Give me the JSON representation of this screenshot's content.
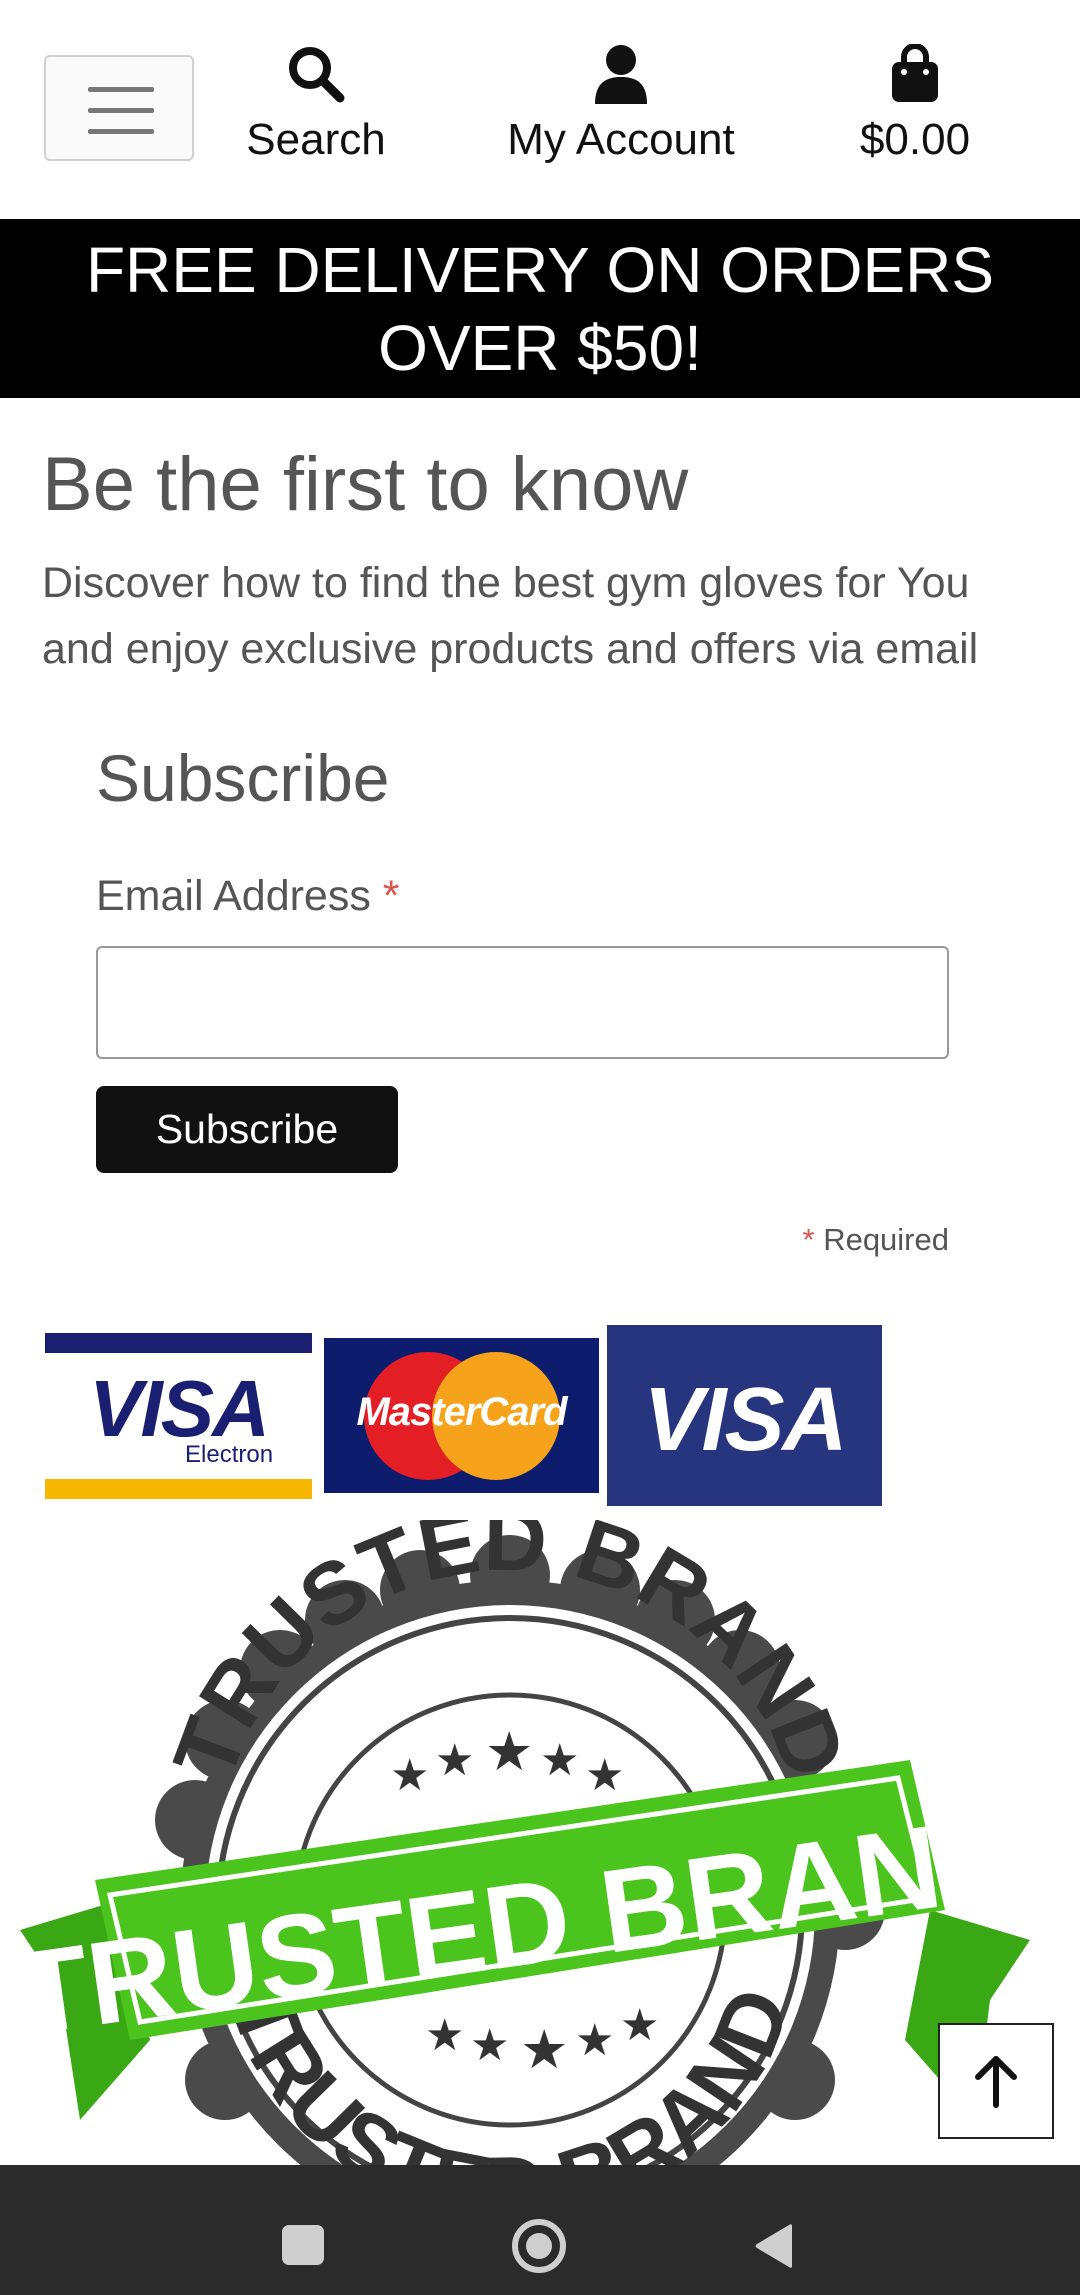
{
  "header": {
    "menu_icon": "hamburger-menu-icon",
    "search": {
      "icon": "search-icon",
      "label": "Search"
    },
    "account": {
      "icon": "user-icon",
      "label": "My Account"
    },
    "cart": {
      "icon": "shopping-bag-icon",
      "total": "$0.00"
    }
  },
  "banner": {
    "line1": "FREE DELIVERY ON ORDERS",
    "line2": "OVER $50!"
  },
  "promo": {
    "title": "Be the first to know",
    "description": "Discover how to find the best gym gloves for You and enjoy exclusive products and offers via email"
  },
  "subscribe_form": {
    "title": "Subscribe",
    "email_label": "Email Address",
    "required_marker": "*",
    "email_value": "",
    "button_label": "Subscribe",
    "required_note": "Required"
  },
  "payment_cards": {
    "visa_electron": {
      "brand": "VISA",
      "sub": "Electron"
    },
    "mastercard": {
      "brand": "MasterCard"
    },
    "visa": {
      "brand": "VISA"
    }
  },
  "badge": {
    "text": "TRUSTED BRAND"
  },
  "back_to_top": {
    "icon": "arrow-up-icon"
  },
  "system_nav": {
    "recents_icon": "square-icon",
    "home_icon": "circle-icon",
    "back_icon": "triangle-back-icon"
  },
  "colors": {
    "banner_bg": "#000000",
    "required_star": "#d9534f",
    "button_bg": "#111111",
    "badge_green": "#4cc41e",
    "badge_ring": "#444444"
  }
}
